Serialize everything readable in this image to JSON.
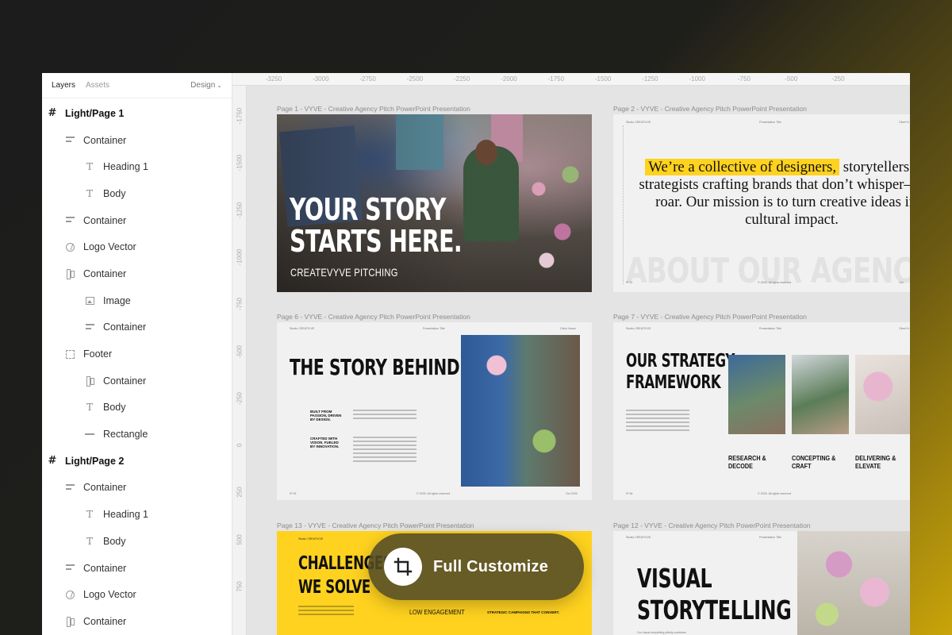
{
  "sidebar": {
    "tabs": {
      "layers": "Layers",
      "assets": "Assets",
      "design": "Design"
    },
    "layers": [
      {
        "label": "Light/Page 1",
        "level": 0,
        "icon": "frame-icon"
      },
      {
        "label": "Container",
        "level": 1,
        "icon": "container-icon"
      },
      {
        "label": "Heading 1",
        "level": 2,
        "icon": "text-icon"
      },
      {
        "label": "Body",
        "level": 2,
        "icon": "text-icon"
      },
      {
        "label": "Container",
        "level": 1,
        "icon": "container-icon"
      },
      {
        "label": "Logo Vector",
        "level": 1,
        "icon": "logo-vector-icon"
      },
      {
        "label": "Container",
        "level": 1,
        "icon": "vertical-container-icon"
      },
      {
        "label": "Image",
        "level": 2,
        "icon": "image-icon"
      },
      {
        "label": "Container",
        "level": 2,
        "icon": "container-icon"
      },
      {
        "label": "Footer",
        "level": 1,
        "icon": "footer-icon"
      },
      {
        "label": "Container",
        "level": 2,
        "icon": "vertical-container-icon"
      },
      {
        "label": "Body",
        "level": 2,
        "icon": "text-icon"
      },
      {
        "label": "Rectangle",
        "level": 2,
        "icon": "rectangle-icon"
      },
      {
        "label": "Light/Page 2",
        "level": 0,
        "icon": "frame-icon"
      },
      {
        "label": "Container",
        "level": 1,
        "icon": "container-icon"
      },
      {
        "label": "Heading 1",
        "level": 2,
        "icon": "text-icon"
      },
      {
        "label": "Body",
        "level": 2,
        "icon": "text-icon"
      },
      {
        "label": "Container",
        "level": 1,
        "icon": "container-icon"
      },
      {
        "label": "Logo Vector",
        "level": 1,
        "icon": "logo-vector-icon"
      },
      {
        "label": "Container",
        "level": 1,
        "icon": "vertical-container-icon"
      }
    ]
  },
  "rulers": {
    "top": [
      "-3250",
      "-3000",
      "-2750",
      "-2500",
      "-2250",
      "-2000",
      "-1750",
      "-1500",
      "-1250",
      "-1000",
      "-750",
      "-500",
      "-250"
    ],
    "left": [
      "-1750",
      "-1500",
      "-1250",
      "-1000",
      "-750",
      "-500",
      "-250",
      "0",
      "250",
      "500",
      "750"
    ]
  },
  "frames": {
    "page1": {
      "label": "Page 1 - VYVE - Creative Agency Pitch PowerPoint Presentation",
      "title_line1": "YOUR STORY",
      "title_line2": "STARTS HERE.",
      "subtitle": "CREATEVYVE PITCHING"
    },
    "page2": {
      "label": "Page 2 - VYVE - Creative Agency Pitch PowerPoint Presentation",
      "header_left": "Studio CREATIVVE",
      "header_mid": "Presentation Title",
      "header_right": "Client N",
      "quote_highlight": "We’re a collective of designers,",
      "quote_rest": "storytellers, and strategists crafting brands that don’t whisper—they roar. Our mission is to turn creative ideas into cultural impact.",
      "ghost_title": "ABOUT OUR AGENCY",
      "footer_left": "/P 02",
      "footer_mid": "© 2025. All rights reserved",
      "footer_right": "Oct"
    },
    "page6": {
      "label": "Page 6 - VYVE - Creative Agency Pitch PowerPoint Presentation",
      "header_left": "Studio CREATIVVE",
      "header_mid": "Presentation Title",
      "header_right": "Client Name",
      "title": "THE STORY BEHIND",
      "bold1": "BUILT FROM PASSION, DRIVEN BY DESIGN.",
      "bold2": "CRAFTED WITH VISION. FUELED BY INNOVATION.",
      "footer_left": "/P 05",
      "footer_mid": "© 2025. All rights reserved",
      "footer_right": "Oct 2026"
    },
    "page7": {
      "label": "Page 7 - VYVE - Creative Agency Pitch PowerPoint Presentation",
      "header_left": "Studio CREATIVVE",
      "header_mid": "Presentation Title",
      "header_right": "Client N",
      "title_line1": "OUR STRATEGY",
      "title_line2": "FRAMEWORK",
      "col1_line1": "RESEARCH &",
      "col1_line2": "DECODE",
      "col2_line1": "CONCEPTING &",
      "col2_line2": "CRAFT",
      "col3_line1": "DELIVERING &",
      "col3_line2": "ELEVATE",
      "footer_left": "/P 06",
      "footer_mid": "© 2025. All rights reserved"
    },
    "page13": {
      "label": "Page 13 - VYVE - Creative Agency Pitch PowerPoint Presentation",
      "header_left": "Studio CREATIVVE",
      "title_line1": "CHALLENGES",
      "title_line2": "WE SOLVE",
      "col1": "LOW ENGAGEMENT",
      "col2_small": "STRATEGIC CAMPAIGNS THAT CONVERT."
    },
    "page12": {
      "label": "Page 12 - VYVE - Creative Agency Pitch PowerPoint Presentation",
      "header_left": "Studio CREATIVVE",
      "header_mid": "Presentation Title",
      "title_line1": "VISUAL",
      "title_line2": "STORYTELLING",
      "caption": "Our visual storytelling pitfully combines"
    }
  },
  "customize": {
    "label": "Full Customize",
    "icon": "crop-icon"
  },
  "colors": {
    "accent_yellow": "#ffd21f",
    "pill_bg": "#524a28"
  }
}
